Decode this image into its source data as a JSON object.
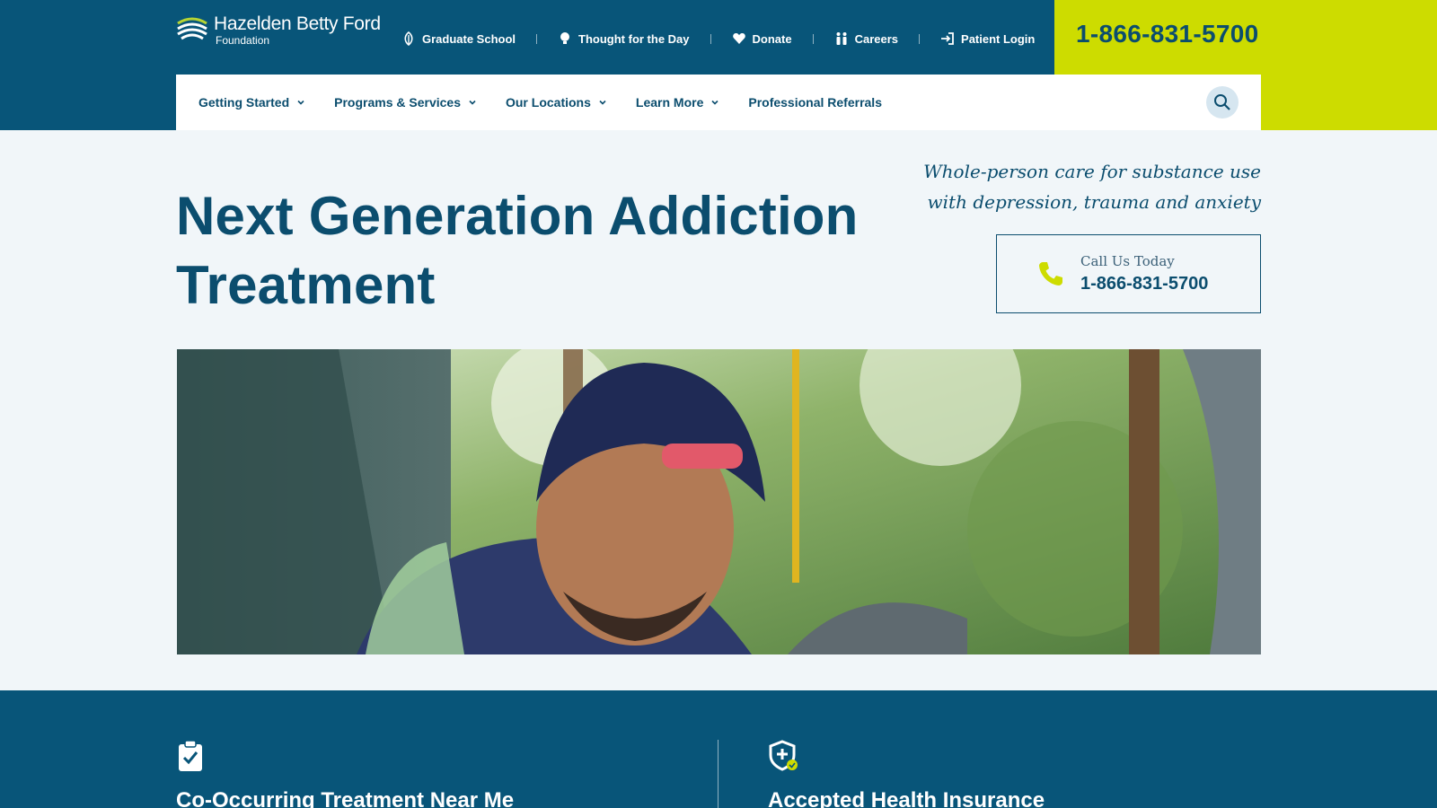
{
  "brand": {
    "name": "Hazelden Betty Ford",
    "sub": "Foundation"
  },
  "utility_nav": [
    {
      "label": "Graduate School",
      "icon": "leaf-icon"
    },
    {
      "label": "Thought for the Day",
      "icon": "lightbulb-icon"
    },
    {
      "label": "Donate",
      "icon": "heart-icon"
    },
    {
      "label": "Careers",
      "icon": "people-icon"
    },
    {
      "label": "Patient Login",
      "icon": "login-icon"
    }
  ],
  "header_phone": "1-866-831-5700",
  "main_nav": [
    {
      "label": "Getting Started",
      "has_dropdown": true
    },
    {
      "label": "Programs & Services",
      "has_dropdown": true
    },
    {
      "label": "Our Locations",
      "has_dropdown": true
    },
    {
      "label": "Learn More",
      "has_dropdown": true
    },
    {
      "label": "Professional Referrals",
      "has_dropdown": false
    }
  ],
  "search": {
    "icon": "search-icon"
  },
  "hero": {
    "title": "Next Generation Addiction Treatment",
    "tagline": "Whole-person care for substance use with depression, trauma and anxiety",
    "call_label": "Call Us Today",
    "call_number": "1-866-831-5700"
  },
  "features": [
    {
      "title": "Co-Occurring Treatment Near Me",
      "icon": "clipboard-check-icon"
    },
    {
      "title": "Accepted Health Insurance",
      "icon": "shield-check-icon"
    }
  ],
  "colors": {
    "navy": "#085579",
    "text": "#0b4d6e",
    "lime": "#cddc00",
    "page_bg": "#f1f6f9"
  }
}
